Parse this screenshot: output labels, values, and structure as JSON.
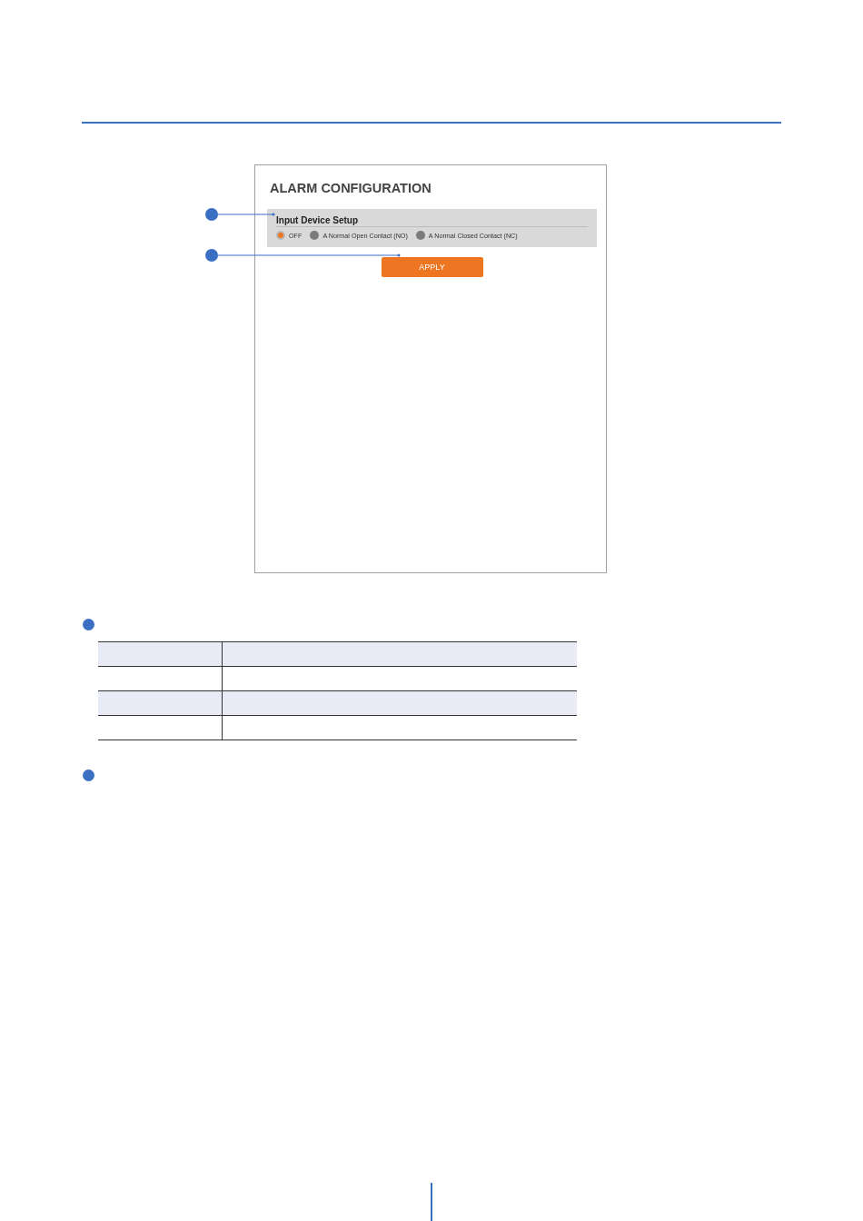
{
  "screen": {
    "title": "ALARM CONFIGURATION",
    "section": {
      "title": "Input Device Setup",
      "options": [
        {
          "label": "OFF",
          "selected": true
        },
        {
          "label": "A Normal Open Contact (NO)",
          "selected": false
        },
        {
          "label": "A Normal Closed Contact (NC)",
          "selected": false
        }
      ]
    },
    "apply_button": "APPLY"
  }
}
